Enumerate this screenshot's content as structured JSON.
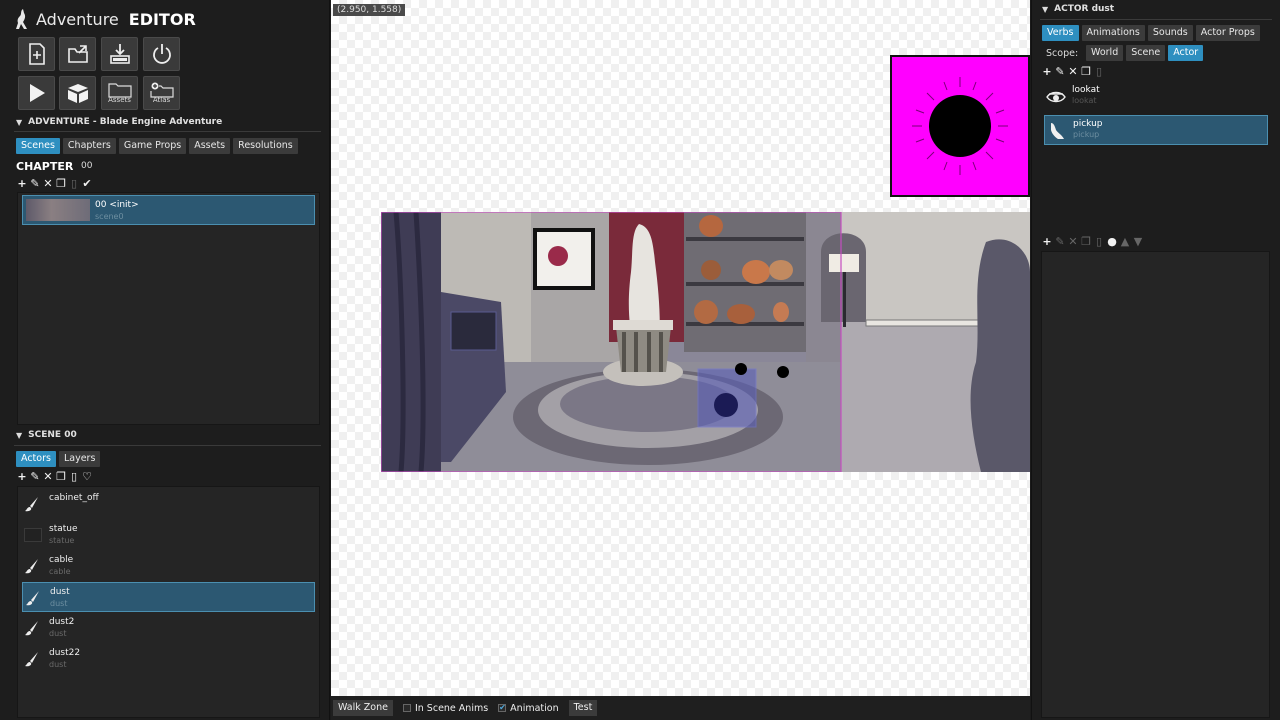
{
  "app": {
    "title_light": "Adventure",
    "title_bold": "EDITOR"
  },
  "toolbar": {
    "row1": [
      {
        "name": "new-project-button",
        "icon": "new-file-icon"
      },
      {
        "name": "open-project-button",
        "icon": "open-folder-icon"
      },
      {
        "name": "save-project-button",
        "icon": "download-save-icon"
      },
      {
        "name": "exit-button",
        "icon": "power-icon"
      }
    ],
    "row2": [
      {
        "name": "play-button",
        "icon": "play-icon"
      },
      {
        "name": "package-button",
        "icon": "box-icon"
      },
      {
        "name": "assets-button",
        "icon": "folder-icon",
        "caption": "Assets"
      },
      {
        "name": "atlas-button",
        "icon": "folder-plus-icon",
        "caption": "Atlas"
      }
    ]
  },
  "project": {
    "header": "ADVENTURE - Blade Engine Adventure",
    "tabs": [
      "Scenes",
      "Chapters",
      "Game Props",
      "Assets",
      "Resolutions"
    ],
    "active_tab": "Scenes",
    "chapter_label": "CHAPTER",
    "chapter_value": "00",
    "scenes": [
      {
        "name": "00 <init>",
        "id": "scene0"
      }
    ]
  },
  "scene": {
    "header": "SCENE 00",
    "tabs": [
      "Actors",
      "Layers"
    ],
    "active_tab": "Actors",
    "actors": [
      {
        "name": "cabinet_off",
        "id": "",
        "icon": "brush-icon",
        "selected": false
      },
      {
        "name": "statue",
        "id": "statue",
        "icon": "empty-thumb-icon",
        "selected": false
      },
      {
        "name": "cable",
        "id": "cable",
        "icon": "brush-icon",
        "selected": false
      },
      {
        "name": "dust",
        "id": "dust",
        "icon": "brush-icon",
        "selected": true
      },
      {
        "name": "dust2",
        "id": "dust",
        "icon": "brush-icon",
        "selected": false
      },
      {
        "name": "dust22",
        "id": "dust",
        "icon": "brush-icon",
        "selected": false
      }
    ]
  },
  "canvas": {
    "coords": "(2.950, 1.558)",
    "bottom": {
      "walk_zone": "Walk Zone",
      "in_scene_anims": "In Scene Anims",
      "in_scene_anims_checked": false,
      "animation": "Animation",
      "animation_checked": true,
      "test": "Test"
    },
    "preview_color": "#ff00ff"
  },
  "actor_panel": {
    "header": "ACTOR dust",
    "tabs": [
      "Verbs",
      "Animations",
      "Sounds",
      "Actor Props"
    ],
    "active_tab": "Verbs",
    "scope_label": "Scope:",
    "scope_options": [
      "World",
      "Scene",
      "Actor"
    ],
    "active_scope": "Actor",
    "verbs": [
      {
        "name": "lookat",
        "id": "lookat",
        "icon": "eye-icon",
        "selected": false
      },
      {
        "name": "pickup",
        "id": "pickup",
        "icon": "hand-icon",
        "selected": true
      }
    ]
  }
}
